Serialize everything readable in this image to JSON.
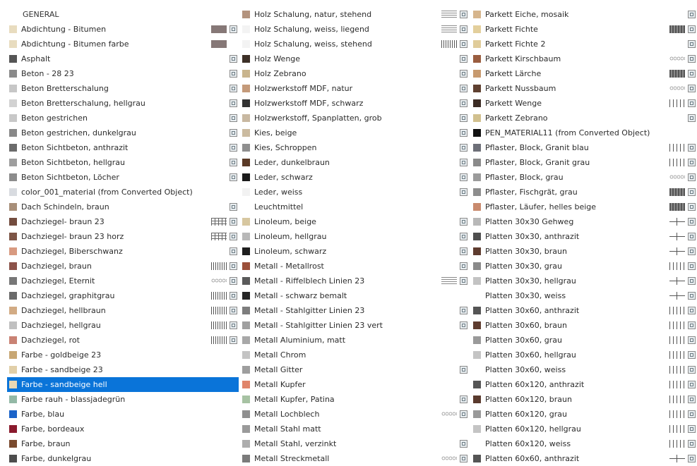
{
  "columns": [
    [
      {
        "label": "GENERAL",
        "header": true
      },
      {
        "label": "Abdichtung - Bitumen",
        "color": "#e8dcbf",
        "pattern": "solid",
        "pcolor": "#867877",
        "icon": true
      },
      {
        "label": "Abdichtung - Bitumen farbe",
        "color": "#e8dcbf",
        "pattern": "solid",
        "pcolor": "#867877",
        "icon": false
      },
      {
        "label": "Asphalt",
        "color": "#555555",
        "icon": true
      },
      {
        "label": "Beton - 28 23",
        "color": "#8a8a8a",
        "icon": true
      },
      {
        "label": "Beton Bretterschalung",
        "color": "#c7c7c7",
        "icon": true
      },
      {
        "label": "Beton Bretterschalung, hellgrau",
        "color": "#d2d2d2",
        "icon": true
      },
      {
        "label": "Beton gestrichen",
        "color": "#c8c8c8",
        "icon": true
      },
      {
        "label": "Beton gestrichen, dunkelgrau",
        "color": "#888888",
        "icon": true
      },
      {
        "label": "Beton Sichtbeton, anthrazit",
        "color": "#6b6b6b",
        "icon": true
      },
      {
        "label": "Beton Sichtbeton, hellgrau",
        "color": "#9e9e9e",
        "icon": true
      },
      {
        "label": "Beton Sichtbeton, Löcher",
        "color": "#8c8c8c",
        "icon": true
      },
      {
        "label": "color_001_material (from Converted Object)",
        "color": "#d8dbe0",
        "icon": false
      },
      {
        "label": "Dach Schindeln, braun",
        "color": "#a88f79",
        "icon": true
      },
      {
        "label": "Dachziegel- braun 23",
        "color": "#734c3e",
        "pattern": "brick",
        "icon": true
      },
      {
        "label": "Dachziegel- braun 23 horz",
        "color": "#7d5546",
        "pattern": "brick",
        "icon": true
      },
      {
        "label": "Dachziegel, Biberschwanz",
        "color": "#d89a80",
        "icon": true
      },
      {
        "label": "Dachziegel, braun",
        "color": "#8c534a",
        "pattern": "vbars",
        "icon": true
      },
      {
        "label": "Dachziegel, Eternit",
        "color": "#777777",
        "pattern": "circles",
        "icon": true
      },
      {
        "label": "Dachziegel, graphitgrau",
        "color": "#6a6a6a",
        "pattern": "vbars",
        "icon": true
      },
      {
        "label": "Dachziegel, hellbraun",
        "color": "#d2ab84",
        "pattern": "vbars",
        "icon": true
      },
      {
        "label": "Dachziegel, hellgrau",
        "color": "#c0c0c0",
        "pattern": "vbars",
        "icon": true
      },
      {
        "label": "Dachziegel, rot",
        "color": "#c98274",
        "pattern": "vbars",
        "icon": true
      },
      {
        "label": "Farbe - goldbeige 23",
        "color": "#c8a774",
        "icon": false
      },
      {
        "label": "Farbe - sandbeige 23",
        "color": "#e1cfa8",
        "icon": false
      },
      {
        "label": "Farbe - sandbeige hell",
        "color": "#e8d8b4",
        "icon": false,
        "selected": true
      },
      {
        "label": "Farbe rauh - blassjadegrün",
        "color": "#93b9a6",
        "icon": false
      },
      {
        "label": "Farbe, blau",
        "color": "#1b63c9",
        "icon": false
      },
      {
        "label": "Farbe, bordeaux",
        "color": "#8a1a2d",
        "icon": false
      },
      {
        "label": "Farbe, braun",
        "color": "#7a4a2e",
        "icon": false
      },
      {
        "label": "Farbe, dunkelgrau",
        "color": "#4d4d4d",
        "icon": false
      }
    ],
    [
      {
        "label": "Holz Schalung, natur, stehend",
        "color": "#b3937e",
        "pattern": "hlines",
        "icon": true
      },
      {
        "label": "Holz Schalung, weiss, liegend",
        "color": "#f3f3f3",
        "pattern": "hlines",
        "icon": true
      },
      {
        "label": "Holz Schalung, weiss, stehend",
        "color": "#f3f3f3",
        "pattern": "vbars",
        "icon": true
      },
      {
        "label": "Holz Wenge",
        "color": "#3d3027",
        "icon": true
      },
      {
        "label": "Holz Zebrano",
        "color": "#c9b58e",
        "icon": true
      },
      {
        "label": "Holzwerkstoff MDF, natur",
        "color": "#c49a7a",
        "icon": true
      },
      {
        "label": "Holzwerkstoff MDF, schwarz",
        "color": "#333333",
        "icon": true
      },
      {
        "label": "Holzwerkstoff, Spanplatten, grob",
        "color": "#c8b8a1",
        "icon": true
      },
      {
        "label": "Kies, beige",
        "color": "#cbbba0",
        "icon": true
      },
      {
        "label": "Kies, Schroppen",
        "color": "#8f8f8f",
        "icon": true
      },
      {
        "label": "Leder, dunkelbraun",
        "color": "#5a3a26",
        "icon": true
      },
      {
        "label": "Leder, schwarz",
        "color": "#1b1b1b",
        "icon": true
      },
      {
        "label": "Leder, weiss",
        "color": "#f2f2f2",
        "icon": true
      },
      {
        "label": "Leuchtmittel",
        "color": "#ffffff",
        "icon": false
      },
      {
        "label": "Linoleum, beige",
        "color": "#d7c7a0",
        "icon": true
      },
      {
        "label": "Linoleum, hellgrau",
        "color": "#b8b8b8",
        "icon": true
      },
      {
        "label": "Linoleum, schwarz",
        "color": "#1e1e1e",
        "icon": true
      },
      {
        "label": "Metall - Metallrost",
        "color": "#9b4f3a",
        "icon": true
      },
      {
        "label": "Metall - Riffelblech Linien 23",
        "color": "#5a5a5a",
        "pattern": "hlines",
        "icon": true
      },
      {
        "label": "Metall - schwarz bemalt",
        "color": "#262626",
        "icon": false
      },
      {
        "label": "Metall - Stahlgitter Linien 23",
        "color": "#7d7d7d",
        "icon": true
      },
      {
        "label": "Metall - Stahlgitter Linien 23 vert",
        "color": "#a0a0a0",
        "icon": true
      },
      {
        "label": "Metall Aluminium, matt",
        "color": "#a8a8a8",
        "icon": false
      },
      {
        "label": "Metall Chrom",
        "color": "#c4c4c4",
        "icon": false
      },
      {
        "label": "Metall Gitter",
        "color": "#9e9e9e",
        "icon": true
      },
      {
        "label": "Metall Kupfer",
        "color": "#e0856a",
        "icon": false
      },
      {
        "label": "Metall Kupfer, Patina",
        "color": "#a7c2a3",
        "icon": true
      },
      {
        "label": "Metall Lochblech",
        "color": "#8f8f8f",
        "pattern": "circles",
        "icon": true
      },
      {
        "label": "Metall Stahl matt",
        "color": "#9a9a9a",
        "icon": false
      },
      {
        "label": "Metall Stahl, verzinkt",
        "color": "#adadad",
        "icon": true
      },
      {
        "label": "Metall Streckmetall",
        "color": "#7b7b7b",
        "pattern": "circles",
        "icon": true
      }
    ],
    [
      {
        "label": "Parkett Eiche, mosaik",
        "color": "#d6b58c",
        "icon": true
      },
      {
        "label": "Parkett Fichte",
        "color": "#e3cf9c",
        "pattern": "dark",
        "icon": true
      },
      {
        "label": "Parkett Fichte 2",
        "color": "#e0cc9a",
        "icon": true
      },
      {
        "label": "Parkett Kirschbaum",
        "color": "#9a5d3f",
        "pattern": "circles",
        "icon": true
      },
      {
        "label": "Parkett Lärche",
        "color": "#c79a6f",
        "pattern": "dark",
        "icon": true
      },
      {
        "label": "Parkett Nussbaum",
        "color": "#5f4030",
        "pattern": "circles",
        "icon": true
      },
      {
        "label": "Parkett Wenge",
        "color": "#3b2b24",
        "pattern": "tiles",
        "icon": true
      },
      {
        "label": "Parkett Zebrano",
        "color": "#d1c08e",
        "icon": true
      },
      {
        "label": "PEN_MATERIAL11 (from Converted Object)",
        "color": "#111111",
        "icon": false
      },
      {
        "label": "Pflaster, Block, Granit blau",
        "color": "#6d6f78",
        "pattern": "tiles",
        "icon": true
      },
      {
        "label": "Pflaster, Block, Granit grau",
        "color": "#8a8a8a",
        "pattern": "tiles",
        "icon": true
      },
      {
        "label": "Pflaster, Block, grau",
        "color": "#9b9b9b",
        "pattern": "circles",
        "icon": true
      },
      {
        "label": "Pflaster, Fischgrät, grau",
        "color": "#8d8d8d",
        "pattern": "dark",
        "icon": true
      },
      {
        "label": "Pflaster, Läufer, helles beige",
        "color": "#c98a6e",
        "pattern": "dark",
        "icon": true
      },
      {
        "label": "Platten 30x30 Gehweg",
        "color": "#b8b8b8",
        "pattern": "cross",
        "icon": true
      },
      {
        "label": "Platten 30x30, anthrazit",
        "color": "#4f4f4f",
        "pattern": "cross",
        "icon": true
      },
      {
        "label": "Platten 30x30, braun",
        "color": "#5e3c2f",
        "pattern": "cross",
        "icon": true
      },
      {
        "label": "Platten 30x30, grau",
        "color": "#8a8a8a",
        "pattern": "tiles",
        "icon": true
      },
      {
        "label": "Platten 30x30, hellgrau",
        "color": "#c3c3c3",
        "pattern": "cross",
        "icon": true
      },
      {
        "label": "Platten 30x30, weiss",
        "color": "#ffffff",
        "pattern": "cross",
        "icon": true
      },
      {
        "label": "Platten 30x60, anthrazit",
        "color": "#555555",
        "pattern": "tiles",
        "icon": true
      },
      {
        "label": "Platten 30x60, braun",
        "color": "#5e3c2f",
        "pattern": "tiles",
        "icon": true
      },
      {
        "label": "Platten 30x60, grau",
        "color": "#9a9a9a",
        "pattern": "tiles",
        "icon": true
      },
      {
        "label": "Platten 30x60, hellgrau",
        "color": "#c4c4c4",
        "pattern": "tiles",
        "icon": true
      },
      {
        "label": "Platten 30x60, weiss",
        "color": "#ffffff",
        "pattern": "tiles",
        "icon": true
      },
      {
        "label": "Platten 60x120, anthrazit",
        "color": "#555555",
        "pattern": "tiles",
        "icon": true
      },
      {
        "label": "Platten 60x120, braun",
        "color": "#5a3a2d",
        "pattern": "tiles",
        "icon": true
      },
      {
        "label": "Platten 60x120, grau",
        "color": "#999999",
        "pattern": "tiles",
        "icon": true
      },
      {
        "label": "Platten 60x120, hellgrau",
        "color": "#c4c4c4",
        "pattern": "tiles",
        "icon": true
      },
      {
        "label": "Platten 60x120, weiss",
        "color": "#ffffff",
        "pattern": "tiles",
        "icon": true
      },
      {
        "label": "Platten 60x60, anthrazit",
        "color": "#555555",
        "pattern": "cross",
        "icon": true
      }
    ]
  ]
}
